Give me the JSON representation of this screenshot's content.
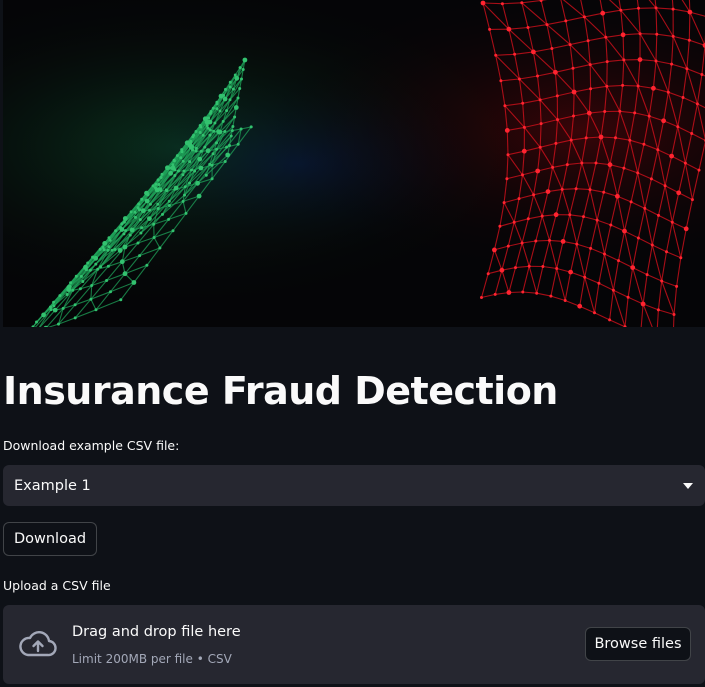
{
  "banner": {
    "icon": "neural-network-banner-image"
  },
  "page": {
    "title": "Insurance Fraud Detection"
  },
  "example": {
    "label": "Download example CSV file:",
    "selected": "Example 1",
    "download_label": "Download"
  },
  "upload": {
    "label": "Upload a CSV file",
    "drop_text": "Drag and drop file here",
    "limit_text": "Limit 200MB per file • CSV",
    "browse_label": "Browse files",
    "icon": "cloud-upload-icon"
  },
  "colors": {
    "background": "#0e1117",
    "widget": "#262730",
    "text": "#fafafa",
    "muted": "#a3a8b8",
    "banner_green": "#1fa35a",
    "banner_red": "#d0101c"
  }
}
